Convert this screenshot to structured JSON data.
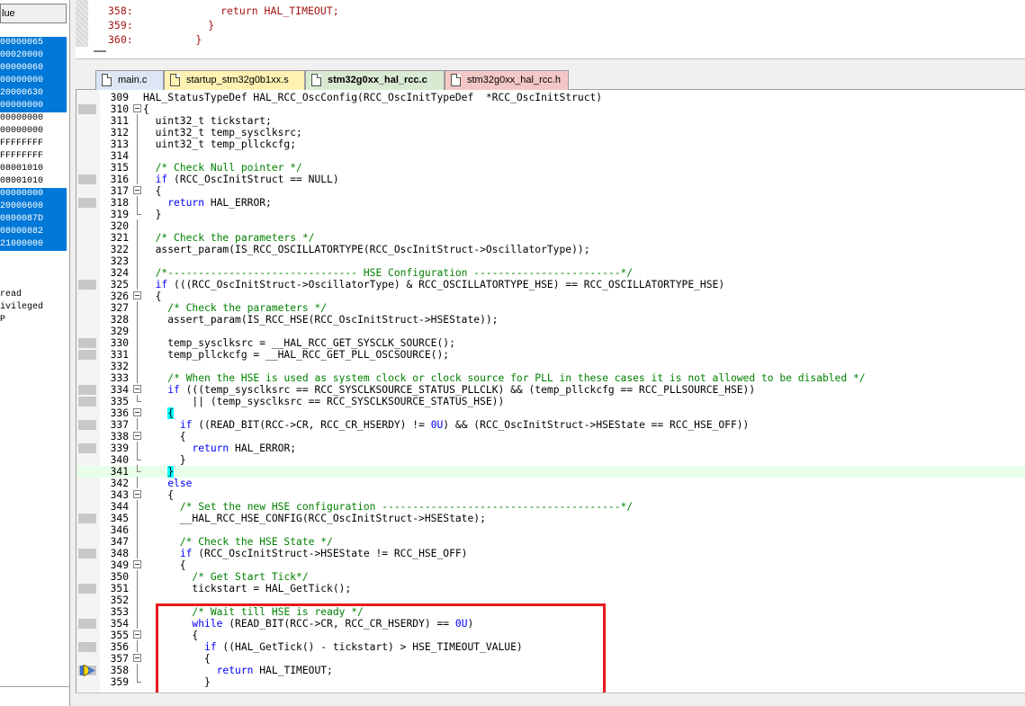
{
  "watch_panel": {
    "header": "lue",
    "rows": [
      {
        "text": "00000065",
        "selected": true
      },
      {
        "text": "00020000",
        "selected": true
      },
      {
        "text": "00000060",
        "selected": true
      },
      {
        "text": "00000000",
        "selected": true
      },
      {
        "text": "20000630",
        "selected": true
      },
      {
        "text": "00000000",
        "selected": true
      },
      {
        "text": "00000000",
        "selected": false
      },
      {
        "text": "00000000",
        "selected": false
      },
      {
        "text": "FFFFFFFF",
        "selected": false
      },
      {
        "text": "FFFFFFFF",
        "selected": false
      },
      {
        "text": "08001010",
        "selected": false
      },
      {
        "text": "08001010",
        "selected": false
      },
      {
        "text": "00000000",
        "selected": true
      },
      {
        "text": "20000600",
        "selected": true
      },
      {
        "text": "0800087D",
        "selected": true
      },
      {
        "text": "08000882",
        "selected": true
      },
      {
        "text": "21000000",
        "selected": true
      }
    ],
    "mode_lines": [
      "read",
      "ivileged",
      "P"
    ]
  },
  "top_code": [
    {
      "num": "358:",
      "text": "            return HAL_TIMEOUT;"
    },
    {
      "num": "359:",
      "text": "          }"
    },
    {
      "num": "360:",
      "text": "        }"
    }
  ],
  "tabs": [
    {
      "label": "main.c",
      "bg": "#dce6f4",
      "icon_color": "#ffffff",
      "active": false
    },
    {
      "label": "startup_stm32g0b1xx.s",
      "bg": "#fff2b3",
      "icon_color": "#fff2b3",
      "active": false
    },
    {
      "label": "stm32g0xx_hal_rcc.c",
      "bg": "#d9ead3",
      "icon_color": "#ffffff",
      "active": true
    },
    {
      "label": "stm32g0xx_hal_rcc.h",
      "bg": "#f4c7c7",
      "icon_color": "#ffffff",
      "active": false
    }
  ],
  "code_lines": [
    {
      "n": "309",
      "html": "HAL_StatusTypeDef HAL_RCC_OscConfig(RCC_OscInitTypeDef  *RCC_OscInitStruct)",
      "fold": "",
      "bp": false
    },
    {
      "n": "310",
      "html": "{",
      "fold": "box",
      "bp": true
    },
    {
      "n": "311",
      "html": "  uint32_t tickstart;",
      "fold": "vline",
      "bp": false
    },
    {
      "n": "312",
      "html": "  uint32_t temp_sysclksrc;",
      "fold": "vline",
      "bp": false
    },
    {
      "n": "313",
      "html": "  uint32_t temp_pllckcfg;",
      "fold": "vline",
      "bp": false
    },
    {
      "n": "314",
      "html": "",
      "fold": "vline",
      "bp": false
    },
    {
      "n": "315",
      "html": "  <span class=\"cm\">/* Check Null pointer */</span>",
      "fold": "vline",
      "bp": false
    },
    {
      "n": "316",
      "html": "  <span class=\"kw\">if</span> (RCC_OscInitStruct == NULL)",
      "fold": "vline",
      "bp": true
    },
    {
      "n": "317",
      "html": "  {",
      "fold": "box",
      "bp": false
    },
    {
      "n": "318",
      "html": "    <span class=\"kw\">return</span> HAL_ERROR;",
      "fold": "vline",
      "bp": true
    },
    {
      "n": "319",
      "html": "  }",
      "fold": "end",
      "bp": false
    },
    {
      "n": "320",
      "html": "",
      "fold": "vline",
      "bp": false
    },
    {
      "n": "321",
      "html": "  <span class=\"cm\">/* Check the parameters */</span>",
      "fold": "vline",
      "bp": false
    },
    {
      "n": "322",
      "html": "  assert_param(IS_RCC_OSCILLATORTYPE(RCC_OscInitStruct-&gt;OscillatorType));",
      "fold": "vline",
      "bp": false
    },
    {
      "n": "323",
      "html": "",
      "fold": "vline",
      "bp": false
    },
    {
      "n": "324",
      "html": "  <span class=\"cm\">/*------------------------------- HSE Configuration ------------------------*/</span>",
      "fold": "vline",
      "bp": false
    },
    {
      "n": "325",
      "html": "  <span class=\"kw\">if</span> (((RCC_OscInitStruct-&gt;OscillatorType) &amp; RCC_OSCILLATORTYPE_HSE) == RCC_OSCILLATORTYPE_HSE)",
      "fold": "vline",
      "bp": true
    },
    {
      "n": "326",
      "html": "  {",
      "fold": "box",
      "bp": false
    },
    {
      "n": "327",
      "html": "    <span class=\"cm\">/* Check the parameters */</span>",
      "fold": "vline",
      "bp": false
    },
    {
      "n": "328",
      "html": "    assert_param(IS_RCC_HSE(RCC_OscInitStruct-&gt;HSEState));",
      "fold": "vline",
      "bp": false
    },
    {
      "n": "329",
      "html": "",
      "fold": "vline",
      "bp": false
    },
    {
      "n": "330",
      "html": "    temp_sysclksrc = __HAL_RCC_GET_SYSCLK_SOURCE();",
      "fold": "vline",
      "bp": true
    },
    {
      "n": "331",
      "html": "    temp_pllckcfg = __HAL_RCC_GET_PLL_OSCSOURCE();",
      "fold": "vline",
      "bp": true
    },
    {
      "n": "332",
      "html": "",
      "fold": "vline",
      "bp": false
    },
    {
      "n": "333",
      "html": "    <span class=\"cm\">/* When the HSE is used as system clock or clock source for PLL in these cases it is not allowed to be disabled */</span>",
      "fold": "vline",
      "bp": false
    },
    {
      "n": "334",
      "html": "    <span class=\"kw\">if</span> (((temp_sysclksrc == RCC_SYSCLKSOURCE_STATUS_PLLCLK) &amp;&amp; (temp_pllckcfg == RCC_PLLSOURCE_HSE))",
      "fold": "box",
      "bp": true
    },
    {
      "n": "335",
      "html": "        || (temp_sysclksrc == RCC_SYSCLKSOURCE_STATUS_HSE))",
      "fold": "end",
      "bp": true
    },
    {
      "n": "336",
      "html": "    <span class=\"bc\">{</span>",
      "fold": "box",
      "bp": false
    },
    {
      "n": "337",
      "html": "      <span class=\"kw\">if</span> ((READ_BIT(RCC-&gt;CR, RCC_CR_HSERDY) != <span class=\"nm\">0U</span>) &amp;&amp; (RCC_OscInitStruct-&gt;HSEState == RCC_HSE_OFF))",
      "fold": "vline",
      "bp": true
    },
    {
      "n": "338",
      "html": "      {",
      "fold": "box",
      "bp": false
    },
    {
      "n": "339",
      "html": "        <span class=\"kw\">return</span> HAL_ERROR;",
      "fold": "vline",
      "bp": true
    },
    {
      "n": "340",
      "html": "      }",
      "fold": "end",
      "bp": false
    },
    {
      "n": "341",
      "html": "    <span class=\"bc\">}</span>",
      "fold": "end",
      "bp": false,
      "hl": true
    },
    {
      "n": "342",
      "html": "    <span class=\"kw\">else</span>",
      "fold": "vline",
      "bp": false
    },
    {
      "n": "343",
      "html": "    {",
      "fold": "box",
      "bp": false
    },
    {
      "n": "344",
      "html": "      <span class=\"cm\">/* Set the new HSE configuration ---------------------------------------*/</span>",
      "fold": "vline",
      "bp": false
    },
    {
      "n": "345",
      "html": "      __HAL_RCC_HSE_CONFIG(RCC_OscInitStruct-&gt;HSEState);",
      "fold": "vline",
      "bp": true
    },
    {
      "n": "346",
      "html": "",
      "fold": "vline",
      "bp": false
    },
    {
      "n": "347",
      "html": "      <span class=\"cm\">/* Check the HSE State */</span>",
      "fold": "vline",
      "bp": false
    },
    {
      "n": "348",
      "html": "      <span class=\"kw\">if</span> (RCC_OscInitStruct-&gt;HSEState != RCC_HSE_OFF)",
      "fold": "vline",
      "bp": true
    },
    {
      "n": "349",
      "html": "      {",
      "fold": "box",
      "bp": false
    },
    {
      "n": "350",
      "html": "        <span class=\"cm\">/* Get Start Tick*/</span>",
      "fold": "vline",
      "bp": false
    },
    {
      "n": "351",
      "html": "        tickstart = HAL_GetTick();",
      "fold": "vline",
      "bp": true
    },
    {
      "n": "352",
      "html": "",
      "fold": "vline",
      "bp": false
    },
    {
      "n": "353",
      "html": "        <span class=\"cm\">/* Wait till HSE is ready */</span>",
      "fold": "vline",
      "bp": false
    },
    {
      "n": "354",
      "html": "        <span class=\"kw\">while</span> (READ_BIT(RCC-&gt;CR, RCC_CR_HSERDY) == <span class=\"nm\">0U</span>)",
      "fold": "vline",
      "bp": true
    },
    {
      "n": "355",
      "html": "        {",
      "fold": "box",
      "bp": false
    },
    {
      "n": "356",
      "html": "          <span class=\"kw\">if</span> ((HAL_GetTick() - tickstart) &gt; HSE_TIMEOUT_VALUE)",
      "fold": "vline",
      "bp": true
    },
    {
      "n": "357",
      "html": "          {",
      "fold": "box",
      "bp": false
    },
    {
      "n": "358",
      "html": "            <span class=\"kw\">return</span> HAL_TIMEOUT;",
      "fold": "vline",
      "bp": true,
      "exec": true
    },
    {
      "n": "359",
      "html": "          }",
      "fold": "end",
      "bp": false
    }
  ],
  "colors": {
    "selection": "#0078d7",
    "highlight_box": "#e8191d",
    "keyword": "#0000ff",
    "comment": "#008000",
    "current_line": "#e8ffe8",
    "brace_match": "#00ffff"
  }
}
